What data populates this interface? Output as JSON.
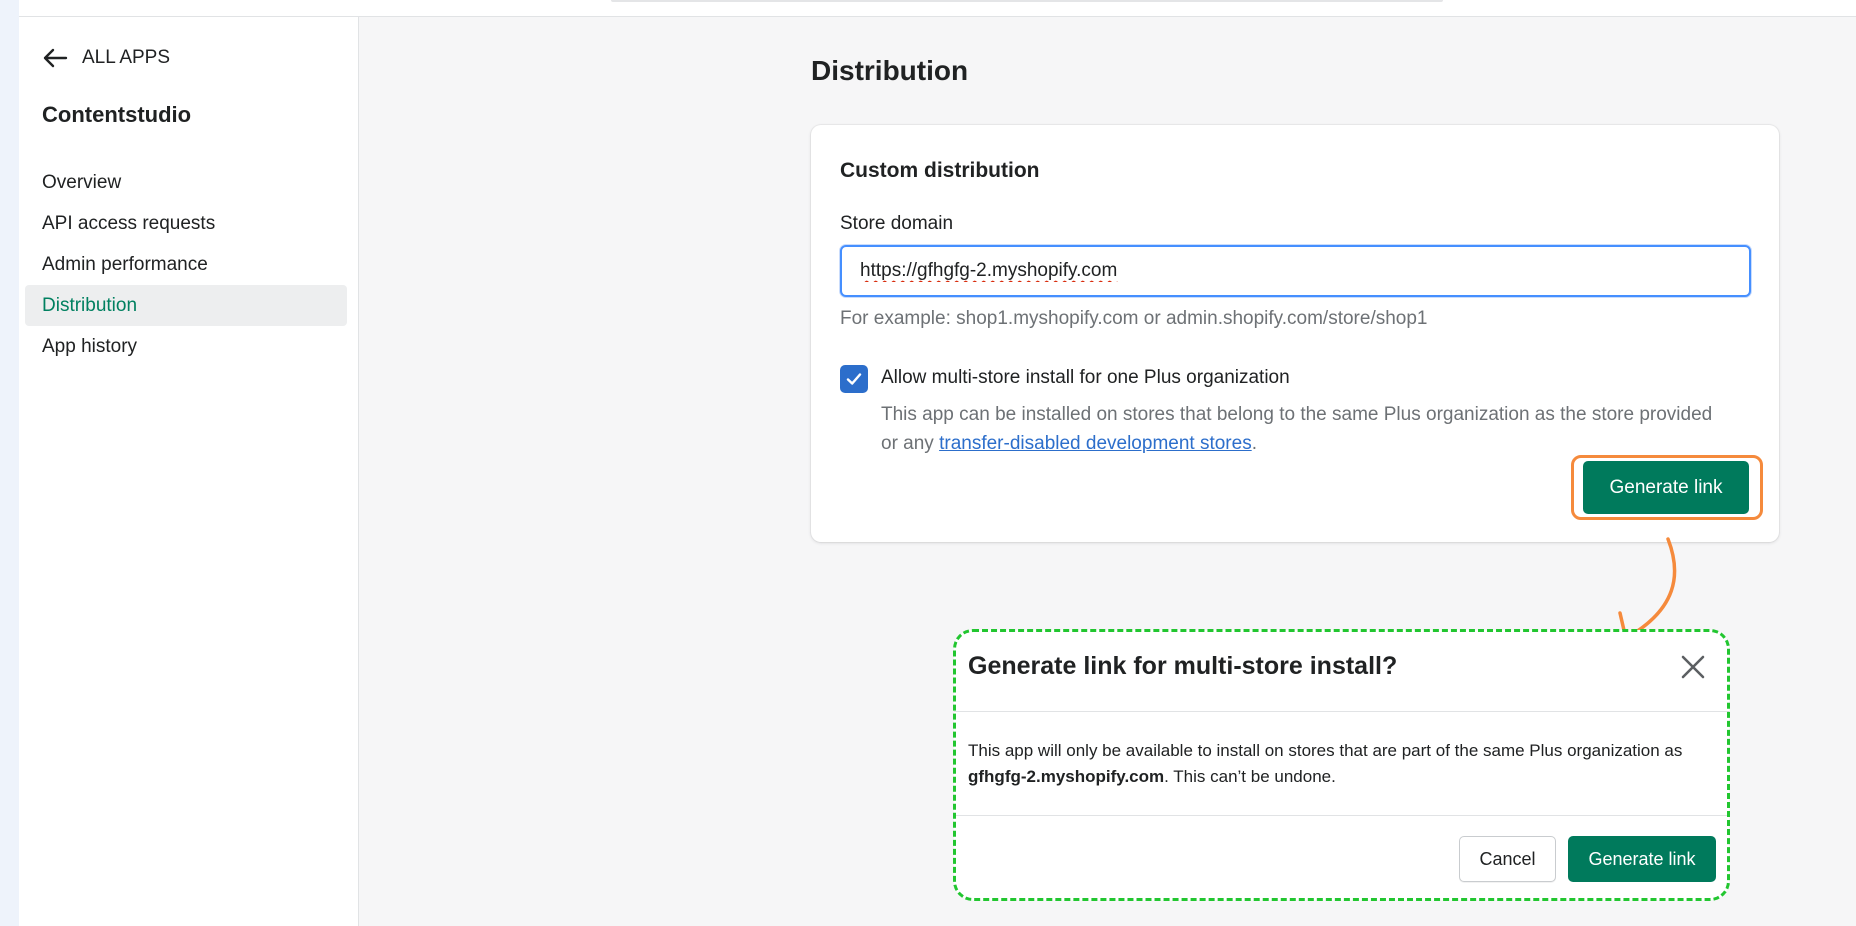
{
  "sidebar": {
    "back_label": "ALL APPS",
    "app_name": "Contentstudio",
    "items": [
      {
        "label": "Overview",
        "active": false
      },
      {
        "label": "API access requests",
        "active": false
      },
      {
        "label": "Admin performance",
        "active": false
      },
      {
        "label": "Distribution",
        "active": true
      },
      {
        "label": "App history",
        "active": false
      }
    ]
  },
  "main": {
    "title": "Distribution",
    "card": {
      "title": "Custom distribution",
      "store_domain_label": "Store domain",
      "store_domain_value": "https://gfhgfg-2.myshopify.com",
      "help_text": "For example: shop1.myshopify.com or admin.shopify.com/store/shop1",
      "checkbox_checked": true,
      "checkbox_label": "Allow multi-store install for one Plus organization",
      "checkbox_desc_prefix": "This app can be installed on stores that belong to the same Plus organization as the store provided or any ",
      "checkbox_desc_link": "transfer-disabled development stores",
      "checkbox_desc_suffix": ".",
      "generate_button": "Generate link"
    }
  },
  "modal": {
    "title": "Generate link for multi-store install?",
    "body_prefix": "This app will only be available to install on stores that are part of the same Plus organization as ",
    "body_store": "gfhgfg-2.myshopify.com",
    "body_suffix": ". This can’t be undone.",
    "cancel_label": "Cancel",
    "confirm_label": "Generate link"
  },
  "colors": {
    "accent_green": "#007a5c",
    "nav_active_text": "#008060",
    "link_blue": "#2c6ecb",
    "highlight_orange": "#f58a3c",
    "highlight_green": "#22c630"
  },
  "icons": {
    "back": "arrow-left-icon",
    "checkbox": "checkmark-icon",
    "close": "close-icon",
    "annotation_arrow": "curved-arrow-icon"
  }
}
